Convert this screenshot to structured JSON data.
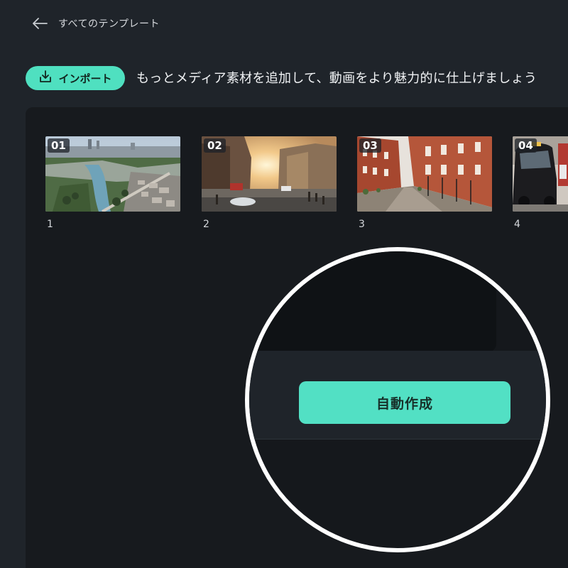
{
  "header": {
    "back_label": "すべてのテンプレート"
  },
  "import_bar": {
    "button_label": "インポート",
    "hint": "もっとメディア素材を追加して、動画をより魅力的に仕上げましょう"
  },
  "media": {
    "items": [
      {
        "badge": "01",
        "caption": "1",
        "image": "aerial city view with river and highway"
      },
      {
        "badge": "02",
        "caption": "2",
        "image": "sunset street with buildings and traffic"
      },
      {
        "badge": "03",
        "caption": "3",
        "image": "red brick townhouse street"
      },
      {
        "badge": "04",
        "caption": "4",
        "image": "black london taxi"
      }
    ]
  },
  "callout": {
    "auto_create_label": "自動作成"
  },
  "colors": {
    "accent": "#4fe0c0",
    "background": "#1f242a",
    "panel": "#171a1e",
    "callout_border": "#ffffff"
  },
  "icons": {
    "back": "arrow-left-icon",
    "import": "download-icon"
  }
}
